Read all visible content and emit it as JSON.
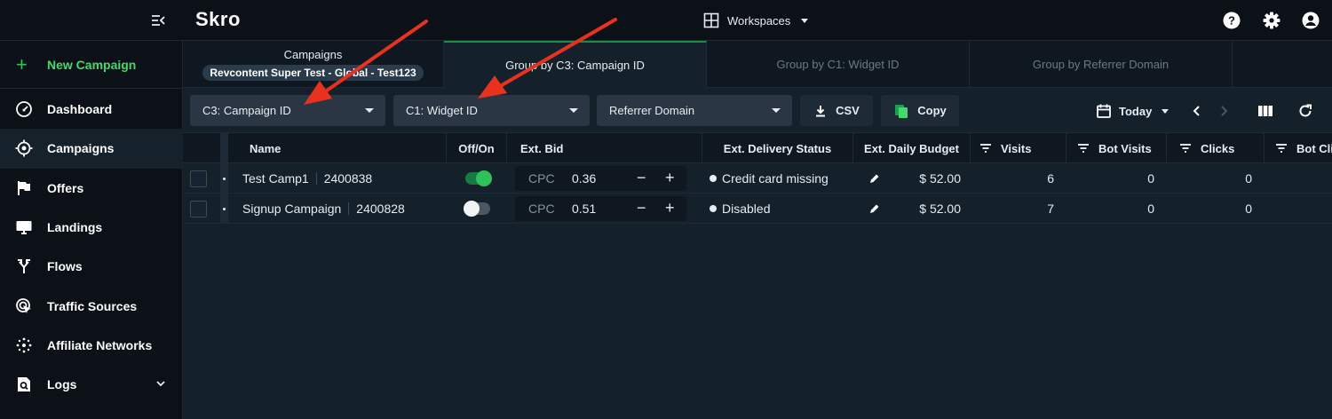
{
  "app": {
    "logo": "Skro"
  },
  "topbar": {
    "workspaces_label": "Workspaces",
    "icons": [
      "collapse-sidebar-icon",
      "grid-icon",
      "help-icon",
      "settings-icon",
      "account-icon"
    ]
  },
  "sidebar": {
    "new_campaign": "New Campaign",
    "items": [
      {
        "label": "Dashboard",
        "icon": "speedometer-icon",
        "active": false
      },
      {
        "label": "Campaigns",
        "icon": "target-icon",
        "active": true
      },
      {
        "label": "Offers",
        "icon": "flag-icon",
        "active": false
      },
      {
        "label": "Landings",
        "icon": "monitor-icon",
        "active": false
      },
      {
        "label": "Flows",
        "icon": "fork-icon",
        "active": false
      },
      {
        "label": "Traffic Sources",
        "icon": "cursor-target-icon",
        "active": false
      },
      {
        "label": "Affiliate Networks",
        "icon": "network-icon",
        "active": false
      },
      {
        "label": "Logs",
        "icon": "log-search-icon",
        "active": false
      }
    ]
  },
  "tabs": {
    "campaigns_title": "Campaigns",
    "campaign_badge": "Revcontent Super Test - Global - Test123",
    "group1": "Group by C3: Campaign ID",
    "group2": "Group by C1: Widget ID",
    "group3": "Group by Referrer Domain"
  },
  "toolbar": {
    "dropdown1": "C3: Campaign ID",
    "dropdown2": "C1: Widget ID",
    "dropdown3": "Referrer Domain",
    "csv": "CSV",
    "copy": "Copy",
    "date": "Today"
  },
  "table": {
    "columns": {
      "name": "Name",
      "offon": "Off/On",
      "bid": "Ext. Bid",
      "delivery": "Ext. Delivery Status",
      "budget": "Ext. Daily Budget",
      "visits": "Visits",
      "bot_visits": "Bot Visits",
      "clicks": "Clicks",
      "bot_clicks": "Bot Cli"
    },
    "rows": [
      {
        "name": "Test Camp1",
        "id": "2400838",
        "on": true,
        "bid_type": "CPC",
        "bid": "0.36",
        "status": "Credit card missing",
        "budget": "$ 52.00",
        "visits": "6",
        "bot_visits": "0",
        "clicks": "0"
      },
      {
        "name": "Signup Campaign",
        "id": "2400828",
        "on": false,
        "bid_type": "CPC",
        "bid": "0.51",
        "status": "Disabled",
        "budget": "$ 52.00",
        "visits": "7",
        "bot_visits": "0",
        "clicks": "0"
      }
    ]
  },
  "colors": {
    "accent_green": "#3ddc6b",
    "toggle_on": "#2ec25a",
    "annotation_arrow": "#e8321e"
  }
}
